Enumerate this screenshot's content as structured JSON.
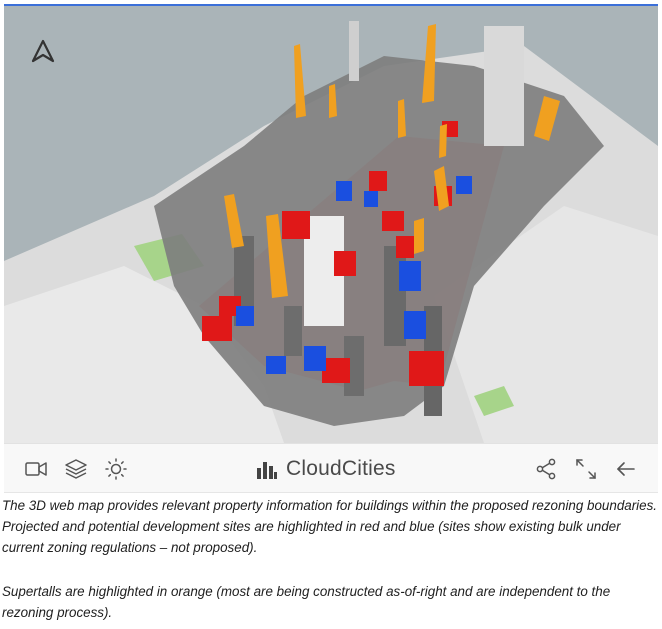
{
  "map": {
    "compass_label": "north-arrow",
    "colors": {
      "ground": "#aab4b8",
      "street_grid": "#ececec",
      "buildings": "#7d7d7d",
      "proposed_blue": "#1a4fe0",
      "proposed_red": "#e01818",
      "supertall_orange": "#f0a020",
      "rezoning_boundary": "#f08080",
      "park": "#a7d48a"
    }
  },
  "toolbar": {
    "icons": [
      "video-camera-icon",
      "layers-icon",
      "sun-icon",
      "share-icon",
      "expand-icon",
      "back-arrow-icon"
    ],
    "brand_name": "CloudCities"
  },
  "caption": {
    "paragraph1": "The 3D web map provides relevant property information for buildings within the proposed rezoning boundaries. Projected and potential development sites are highlighted in red and blue (sites show existing bulk under current zoning regulations – not proposed).",
    "paragraph2": "Supertalls are highlighted in orange (most are being constructed as-of-right and are independent to the rezoning process)."
  }
}
